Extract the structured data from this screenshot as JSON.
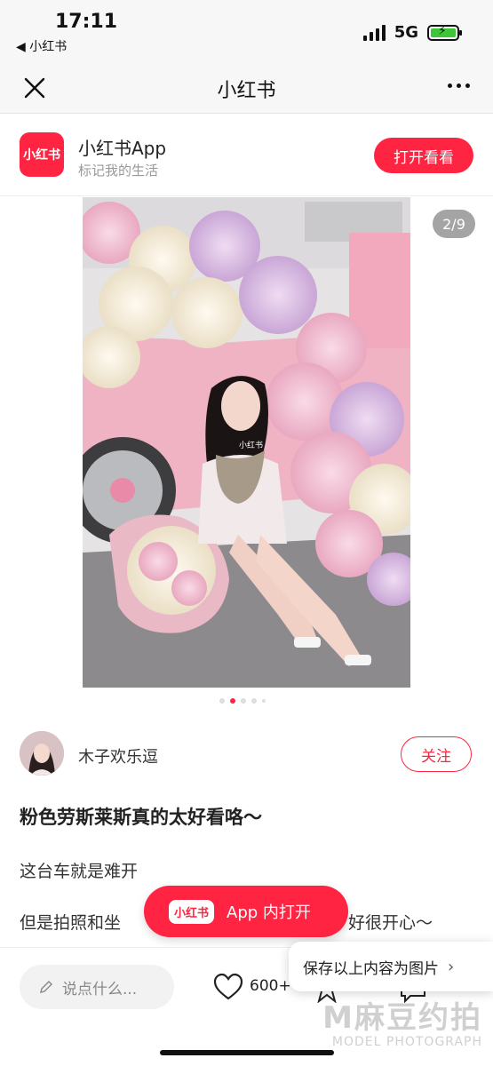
{
  "status_bar": {
    "time": "17:11",
    "back_app": "◀ 小红书",
    "network": "5G",
    "battery_percent": 100
  },
  "nav": {
    "title": "小红书"
  },
  "banner": {
    "logo_text": "小红书",
    "app_name": "小红书App",
    "tagline": "标记我的生活",
    "open_button": "打开看看"
  },
  "gallery": {
    "page_indicator": "2/9",
    "photo_watermark": "小红书",
    "dot_count": 5,
    "active_index": 1
  },
  "author": {
    "name": "木子欢乐逗",
    "follow_label": "关注"
  },
  "post": {
    "title": "粉色劳斯莱斯真的太好看咯～",
    "line1": "这台车就是难开",
    "line2_left": "但是拍照和坐",
    "line2_right": "好很开心～"
  },
  "app_pill": {
    "badge": "小红书",
    "label": "App 内打开"
  },
  "bottom_bar": {
    "comment_placeholder": "说点什么...",
    "like_count": "600+"
  },
  "save_popup": {
    "label": "保存以上内容为图片",
    "chevron": "›"
  },
  "watermark": {
    "main": "M麻豆约拍",
    "sub": "MODEL PHOTOGRAPH"
  },
  "colors": {
    "brand_red": "#ff2442",
    "battery_green": "#3fc53a"
  },
  "icons": [
    "close-icon",
    "more-icon",
    "pencil-icon",
    "heart-icon",
    "star-icon",
    "comment-icon"
  ]
}
